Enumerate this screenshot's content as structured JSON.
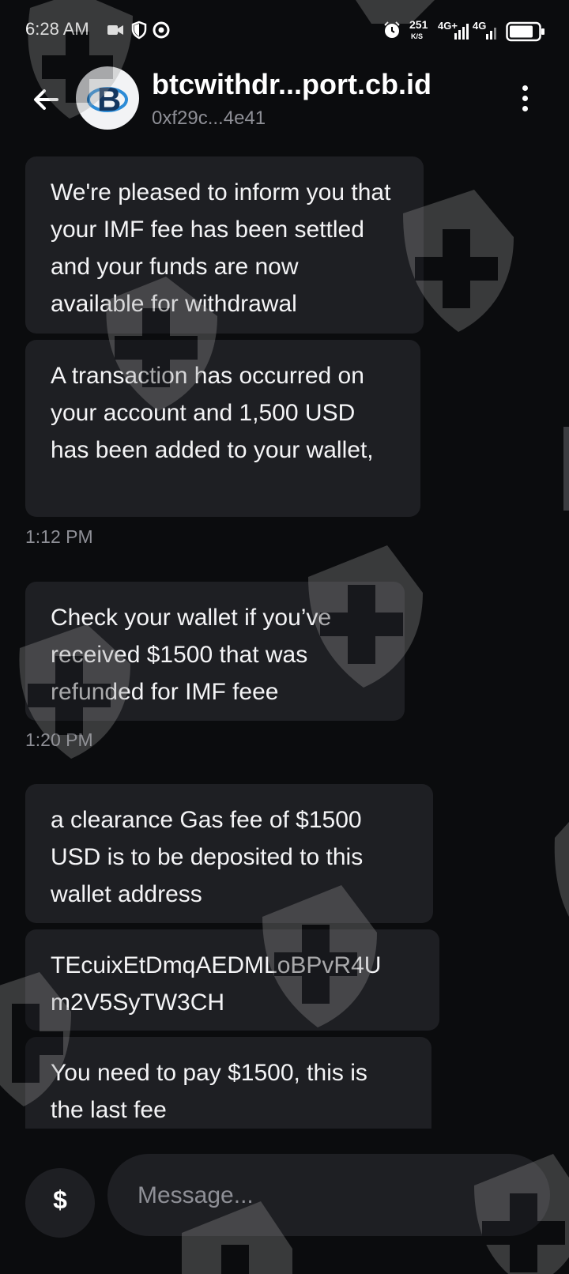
{
  "status_bar": {
    "time": "6:28 AM",
    "speed_value": "251",
    "speed_unit": "K/S",
    "net1": "4G+",
    "net2": "4G",
    "icons": [
      "video-icon",
      "shield-icon",
      "record-icon",
      "alarm-icon",
      "signal-icon",
      "battery-icon"
    ]
  },
  "header": {
    "title": "btcwithdr...port.cb.id",
    "subtitle": "0xf29c...4e41",
    "avatar_letter": "B",
    "back_icon": "arrow-left-icon",
    "menu_icon": "more-vertical-icon"
  },
  "messages": [
    {
      "text": "We're pleased to inform you that your IMF fee has been settled and your funds are now available for withdrawal"
    },
    {
      "text": "A transaction has occurred on your account and 1,500 USD has been added to your wallet,"
    },
    {
      "timestamp": "1:12 PM"
    },
    {
      "text": "Check your wallet if you’ve received $1500 that was refunded for IMF feee"
    },
    {
      "timestamp": "1:20 PM"
    },
    {
      "text": "a clearance Gas fee of $1500 USD is to be deposited to this wallet address"
    },
    {
      "text": "TEcuixEtDmqAEDMLoBPvR4U m2V5SyTW3CH"
    },
    {
      "text": "You need to pay $1500, this is the last fee"
    }
  ],
  "composer": {
    "dollar_label": "$",
    "placeholder": "Message..."
  },
  "colors": {
    "background": "#0b0c0e",
    "bubble": "#1e1f23",
    "muted": "#8e8f96"
  }
}
